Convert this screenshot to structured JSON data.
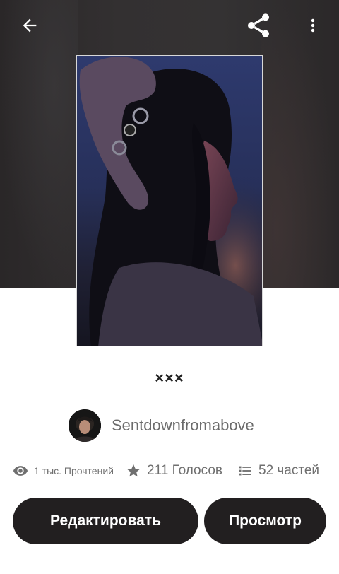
{
  "top_bar": {
    "back_icon": "arrow-left-icon",
    "share_icon": "share-icon",
    "more_icon": "more-vertical-icon",
    "icon_color": "#ffffff"
  },
  "story": {
    "title": "×××",
    "author": "Sentdownfromabove"
  },
  "stats": {
    "reads": "1 тыс. Прочтений",
    "votes": "211 Голосов",
    "parts": "52 частей",
    "icons": [
      "eye-icon",
      "star-icon",
      "list-icon"
    ]
  },
  "actions": {
    "edit_label": "Редактировать",
    "view_label": "Просмотр"
  },
  "colors": {
    "header_bg": "#302d2e",
    "button_bg": "#221f20",
    "button_text": "#ffffff",
    "secondary_text": "#6f6f6f"
  }
}
